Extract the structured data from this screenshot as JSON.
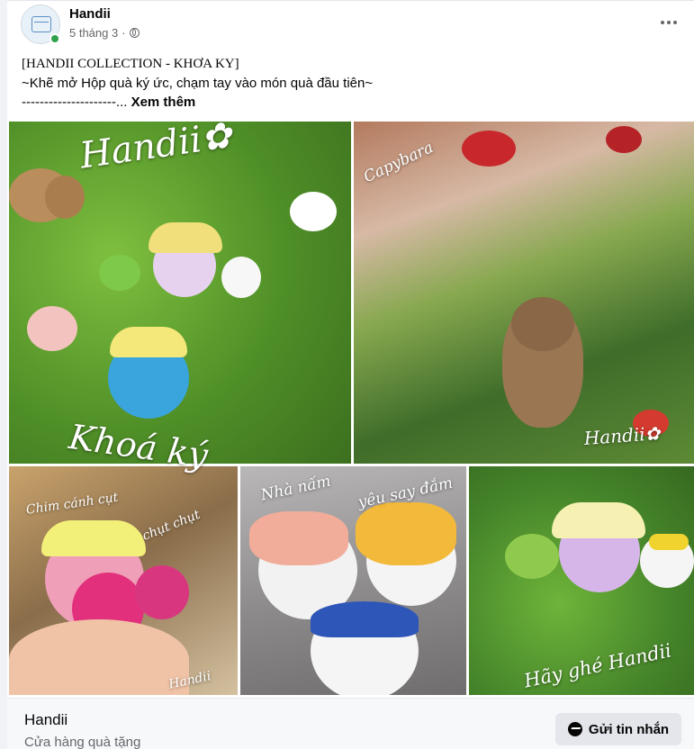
{
  "post": {
    "page_name": "Handii",
    "time": "5 tháng 3",
    "separator": "·",
    "text_line1": "[HANDII COLLECTION - KHƠA KY]",
    "text_line2": "~Khẽ mở Hộp quà ký ức, chạm tay vào món quà đầu tiên~",
    "text_line3": "---------------------...",
    "see_more": "Xem thêm"
  },
  "photos": {
    "p1_caption_top": "Handii✿",
    "p1_caption_bottom": "Khoá ký",
    "p2_caption_top": "Capybara",
    "p2_caption_bottom": "Handii✿",
    "p3_caption_a": "Chim cánh cụt",
    "p3_caption_b": "chụt chụt",
    "p3_caption_c": "Handii",
    "p4_caption_a": "Nhà nấm",
    "p4_caption_b": "yêu say đắm",
    "p5_caption": "Hãy ghé Handii"
  },
  "footer": {
    "name": "Handii",
    "category": "Cửa hàng quà tặng",
    "message_button": "Gửi tin nhắn"
  }
}
